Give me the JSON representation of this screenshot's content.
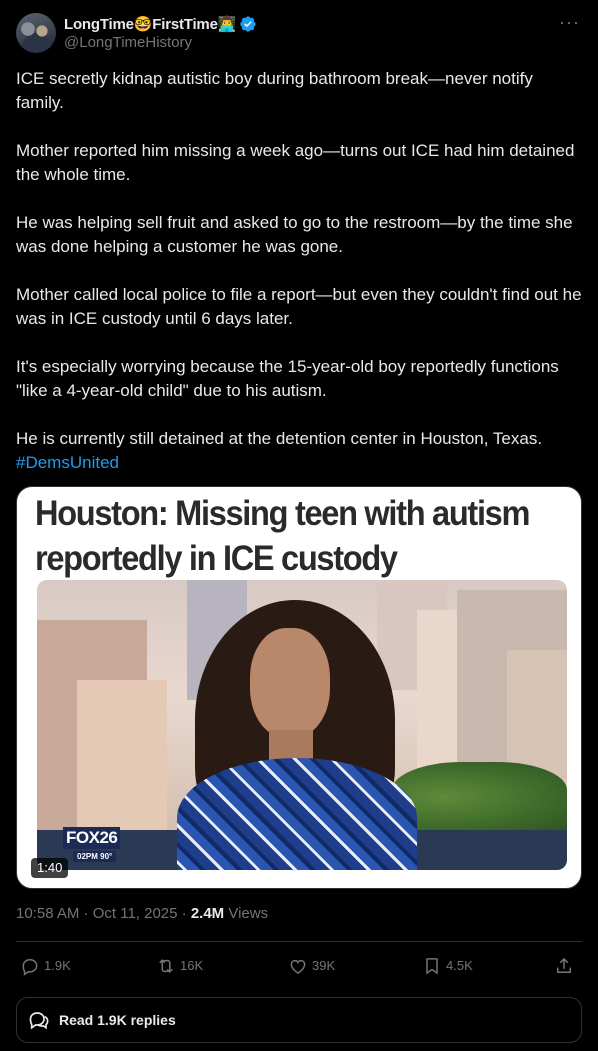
{
  "author": {
    "display_name": "LongTime🤓FirstTime👨‍💻",
    "handle": "@LongTimeHistory",
    "more_label": "···"
  },
  "tweet": {
    "paragraphs": [
      "ICE secretly kidnap autistic boy during bathroom break—never notify family.",
      "Mother reported him missing a week ago—turns out ICE had him detained the whole time.",
      "He was helping sell fruit and asked to go to the restroom—by the time she was done helping a customer he was gone.",
      "Mother called local police to file a report—but even they couldn't find out he was in ICE custody until 6 days later.",
      "It's especially worrying because the 15-year-old boy reportedly functions \"like a 4-year-old child\" due to his autism.",
      "He is currently still detained at the detention center in Houston, Texas."
    ],
    "hashtag": "#DemsUnited"
  },
  "media": {
    "headline_line1": "Houston: Missing teen with autism",
    "headline_line2": "reportedly in ICE custody",
    "station_logo": "FOX26",
    "station_ticker": "02PM  90°",
    "duration": "1:40"
  },
  "meta": {
    "timestamp": "10:58 AM · Oct 11, 2025 · ",
    "views_count": "2.4M",
    "views_label": " Views"
  },
  "actions": {
    "replies": "1.9K",
    "reposts": "16K",
    "likes": "39K",
    "bookmarks": "4.5K"
  },
  "replies_button": {
    "label": "Read 1.9K replies"
  },
  "colors": {
    "background": "#000000",
    "text": "#e7e9ea",
    "secondary": "#71767b",
    "link": "#1d9bf0",
    "border": "#2f3336"
  }
}
